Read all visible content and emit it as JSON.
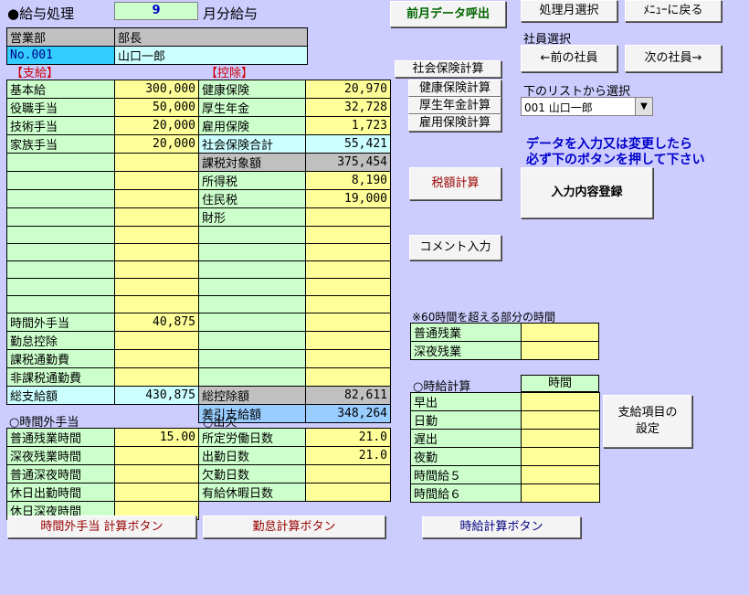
{
  "header": {
    "title": "●給与処理",
    "month_value": "9",
    "month_suffix": "月分給与"
  },
  "buttons": {
    "prev_month_data": "前月データ呼出",
    "select_month": "処理月選択",
    "back_to_menu": "ﾒﾆｭｰに戻る",
    "social_insurance_calc": "社会保険計算",
    "health_insurance_calc": "健康保険計算",
    "pension_calc": "厚生年金計算",
    "employment_insurance_calc": "雇用保険計算",
    "prev_employee": "←前の社員",
    "next_employee": "次の社員→",
    "tax_calc": "税額計算",
    "register": "入力内容登録",
    "comment_input": "コメント入力",
    "allowance_settings": "支給項目の\n設定",
    "overtime_calc": "時間外手当 計算ボタン",
    "attendance_calc": "勤怠計算ボタン",
    "hourly_calc": "時給計算ボタン"
  },
  "employee": {
    "dept_header": "営業部",
    "position_header": "部長",
    "number": "No.001",
    "name": "山口一郎"
  },
  "employee_select": {
    "label": "社員選択",
    "list_label": "下のリストから選択",
    "selected": "001 山口一郎"
  },
  "notice": {
    "line1": "データを入力又は変更したら",
    "line2": "必ず下のボタンを押して下さい"
  },
  "payments": {
    "header": "【支給】",
    "rows": [
      {
        "label": "基本給",
        "value": "300,000"
      },
      {
        "label": "役職手当",
        "value": "50,000"
      },
      {
        "label": "技術手当",
        "value": "20,000"
      },
      {
        "label": "家族手当",
        "value": "20,000"
      },
      {
        "label": "",
        "value": ""
      },
      {
        "label": "",
        "value": ""
      },
      {
        "label": "",
        "value": ""
      },
      {
        "label": "",
        "value": ""
      },
      {
        "label": "",
        "value": ""
      },
      {
        "label": "",
        "value": ""
      },
      {
        "label": "",
        "value": ""
      },
      {
        "label": "",
        "value": ""
      },
      {
        "label": "",
        "value": ""
      },
      {
        "label": "時間外手当",
        "value": "40,875"
      },
      {
        "label": "勤怠控除",
        "value": ""
      },
      {
        "label": "課税通勤費",
        "value": ""
      },
      {
        "label": "非課税通勤費",
        "value": ""
      }
    ],
    "total_label": "総支給額",
    "total_value": "430,875"
  },
  "deductions": {
    "header": "【控除】",
    "rows": [
      {
        "label": "健康保険",
        "value": "20,970"
      },
      {
        "label": "厚生年金",
        "value": "32,728"
      },
      {
        "label": "雇用保険",
        "value": "1,723"
      },
      {
        "label": "社会保険合計",
        "value": "55,421"
      },
      {
        "label": "課税対象額",
        "value": "375,454"
      },
      {
        "label": "所得税",
        "value": "8,190"
      },
      {
        "label": "住民税",
        "value": "19,000"
      },
      {
        "label": "財形",
        "value": ""
      },
      {
        "label": "",
        "value": ""
      },
      {
        "label": "",
        "value": ""
      },
      {
        "label": "",
        "value": ""
      },
      {
        "label": "",
        "value": ""
      },
      {
        "label": "",
        "value": ""
      },
      {
        "label": "",
        "value": ""
      },
      {
        "label": "",
        "value": ""
      },
      {
        "label": "",
        "value": ""
      },
      {
        "label": "",
        "value": ""
      }
    ],
    "total_label": "総控除額",
    "total_value": "82,611",
    "net_label": "差引支給額",
    "net_value": "348,264"
  },
  "overtime": {
    "header": "○時間外手当",
    "rows": [
      {
        "label": "普通残業時間",
        "value": "15.00"
      },
      {
        "label": "深夜残業時間",
        "value": ""
      },
      {
        "label": "普通深夜時間",
        "value": ""
      },
      {
        "label": "休日出勤時間",
        "value": ""
      },
      {
        "label": "休日深夜時間",
        "value": ""
      }
    ]
  },
  "attendance": {
    "header": "○出欠",
    "rows": [
      {
        "label": "所定労働日数",
        "value": "21.0"
      },
      {
        "label": "出勤日数",
        "value": "21.0"
      },
      {
        "label": "欠勤日数",
        "value": ""
      },
      {
        "label": "有給休暇日数",
        "value": ""
      }
    ]
  },
  "over60": {
    "header": "※60時間を超える部分の時間",
    "rows": [
      {
        "label": "普通残業",
        "value": ""
      },
      {
        "label": "深夜残業",
        "value": ""
      }
    ]
  },
  "hourly": {
    "header": "○時給計算",
    "col_header": "時間",
    "rows": [
      {
        "label": "早出",
        "value": ""
      },
      {
        "label": "日勤",
        "value": ""
      },
      {
        "label": "遅出",
        "value": ""
      },
      {
        "label": "夜勤",
        "value": ""
      },
      {
        "label": "時間給５",
        "value": ""
      },
      {
        "label": "時間給６",
        "value": ""
      }
    ]
  }
}
